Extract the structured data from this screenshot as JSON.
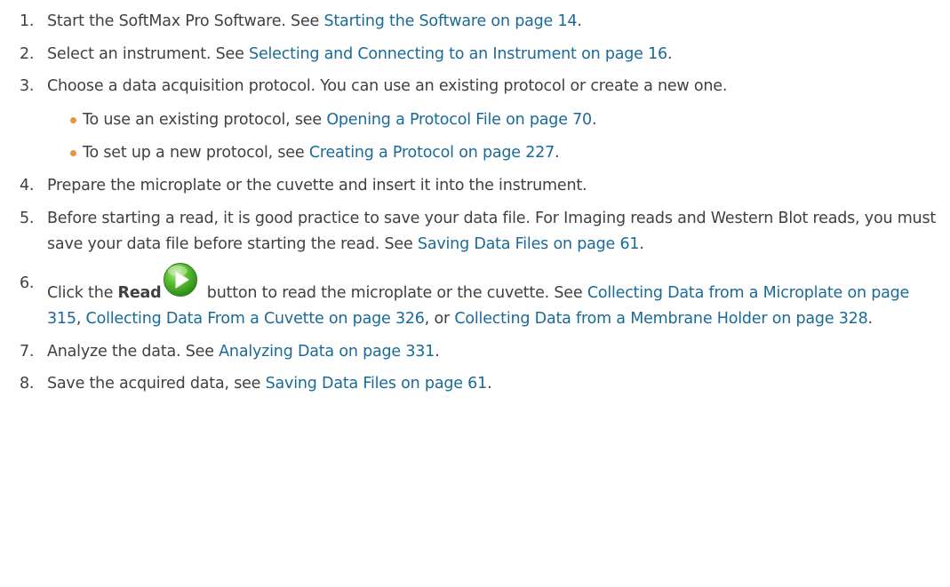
{
  "steps": [
    {
      "num": "1.",
      "text": "Start the SoftMax Pro Software. See ",
      "link": "Starting the Software on page 14",
      "after": "."
    },
    {
      "num": "2.",
      "text": "Select an instrument. See ",
      "link": "Selecting and Connecting to an Instrument on page 16",
      "after": "."
    },
    {
      "num": "3.",
      "text": "Choose a data acquisition protocol. You can use an existing protocol or create a new one.",
      "bullets": [
        {
          "text": "To use an existing protocol, see ",
          "link": "Opening a Protocol File on page 70",
          "after": "."
        },
        {
          "text": "To set up a new protocol, see ",
          "link": "Creating a Protocol on page 227",
          "after": "."
        }
      ]
    },
    {
      "num": "4.",
      "text": "Prepare the microplate or the cuvette and insert it into the instrument."
    },
    {
      "num": "5.",
      "text": "Before starting a read, it is good practice to save your data file. For Imaging reads and Western Blot reads, you must save your data file before starting the read. See ",
      "link": "Saving Data Files on page 61",
      "after": "."
    },
    {
      "num": "6.",
      "text_pre": "Click the ",
      "bold": "Read",
      "icon": "read-play-icon",
      "text_post": " button to read the microplate or the cuvette. See ",
      "link1": "Collecting Data from a Microplate on page 315",
      "sep1": ", ",
      "link2": "Collecting Data From a Cuvette on page 326",
      "sep2": ", or ",
      "link3": "Collecting Data from a Membrane Holder on page 328",
      "after": "."
    },
    {
      "num": "7.",
      "text": "Analyze the data. See ",
      "link": "Analyzing Data on page 331",
      "after": "."
    },
    {
      "num": "8.",
      "text": "Save the acquired data, see ",
      "link": "Saving Data Files on page 61",
      "after": "."
    }
  ],
  "colors": {
    "text": "#404040",
    "link": "#1a6a98",
    "bullet": "#e8953a",
    "icon_green": "#4caf2a"
  }
}
